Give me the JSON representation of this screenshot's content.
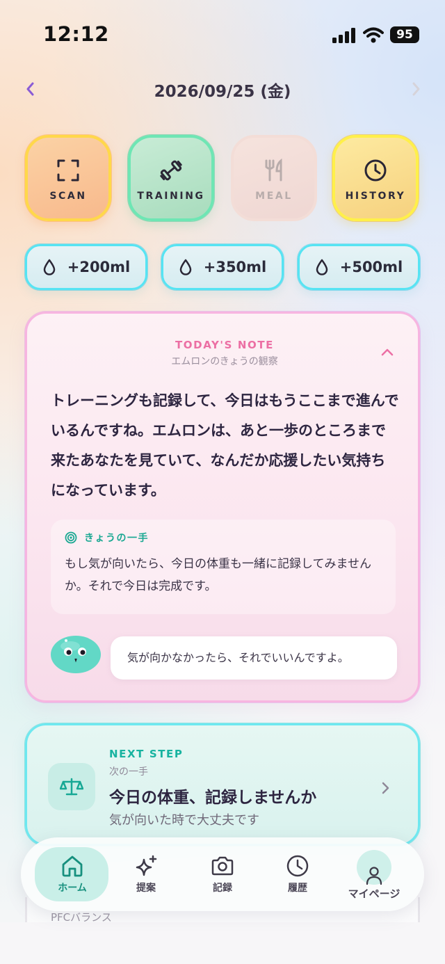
{
  "status_bar": {
    "time": "12:12",
    "battery": "95"
  },
  "header": {
    "date": "2026/09/25 (金)",
    "prev_icon": "chevron-left-icon",
    "next_icon": "chevron-right-icon"
  },
  "quick_actions": [
    {
      "label": "SCAN",
      "icon": "scan-icon"
    },
    {
      "label": "TRAINING",
      "icon": "dumbbell-icon"
    },
    {
      "label": "MEAL",
      "icon": "fork-knife-icon"
    },
    {
      "label": "HISTORY",
      "icon": "clock-icon"
    }
  ],
  "water_buttons": [
    {
      "label": "+200ml",
      "icon": "water-drop-icon"
    },
    {
      "label": "+350ml",
      "icon": "water-drop-icon"
    },
    {
      "label": "+500ml",
      "icon": "water-drop-icon"
    }
  ],
  "note": {
    "kicker": "TODAY'S NOTE",
    "subtitle": "エムロンのきょうの観察",
    "body": "トレーニングも記録して、今日はもうここまで進んでいるんですね。エムロンは、あと一歩のところまで来たあなたを見ていて、なんだか応援したい気持ちになっています。",
    "tip_title": "きょうの一手",
    "tip_body": "もし気が向いたら、今日の体重も一緒に記録してみませんか。それで今日は完成です。",
    "bubble": "気が向かなかったら、それでいいんですよ。"
  },
  "next_step": {
    "kicker": "NEXT STEP",
    "subtitle": "次の一手",
    "title": "今日の体重、記録しませんか",
    "hint": "気が向いた時で大丈夫です"
  },
  "pfc": {
    "label": "PFCバランス"
  },
  "tabs": [
    {
      "label": "ホーム",
      "active": true
    },
    {
      "label": "提案"
    },
    {
      "label": "記録"
    },
    {
      "label": "履歴"
    },
    {
      "label": "マイページ"
    }
  ],
  "colors": {
    "accent_teal": "#17b3a0",
    "accent_pink": "#ec6fa4",
    "nav_purple": "#8a5cd6"
  }
}
